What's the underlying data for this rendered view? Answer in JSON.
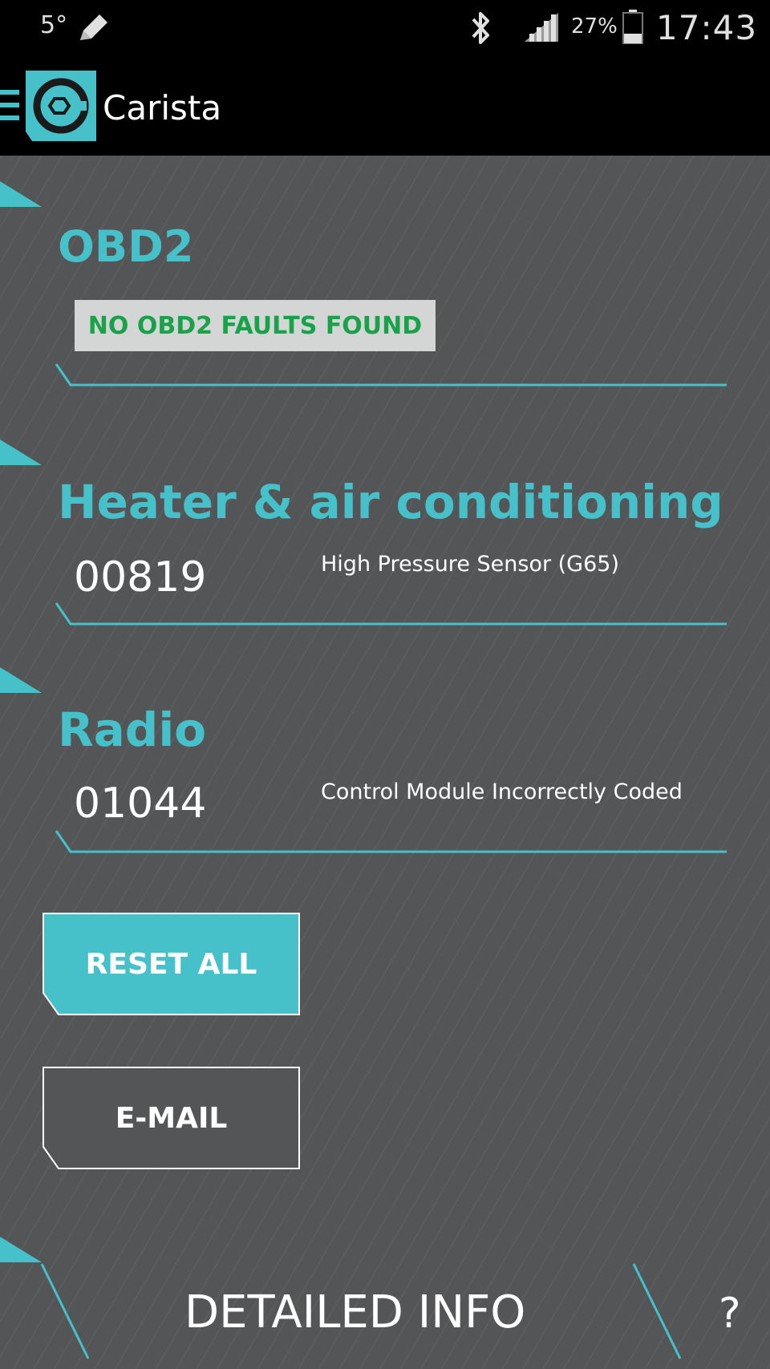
{
  "status_bar": {
    "temperature": "5°",
    "battery_percent": "27%",
    "time": "17:43",
    "icons": [
      "pencil-icon",
      "bluetooth-icon",
      "signal-icon",
      "battery-icon"
    ]
  },
  "app_bar": {
    "title": "Carista",
    "icons": [
      "menu-icon",
      "carista-logo-icon"
    ]
  },
  "colors": {
    "accent": "#46c1ca",
    "background": "#545557",
    "ok_green": "#1aa24a"
  },
  "sections": [
    {
      "title": "OBD2",
      "status": "NO OBD2 FAULTS FOUND"
    },
    {
      "title": "Heater & air conditioning",
      "faults": [
        {
          "code": "00819",
          "description": "High Pressure Sensor (G65)"
        }
      ]
    },
    {
      "title": "Radio",
      "faults": [
        {
          "code": "01044",
          "description": "Control Module Incorrectly Coded"
        }
      ]
    }
  ],
  "buttons": {
    "reset_all": "RESET ALL",
    "email": "E-MAIL"
  },
  "footer": {
    "detailed_info": "DETAILED INFO",
    "help": "?"
  }
}
